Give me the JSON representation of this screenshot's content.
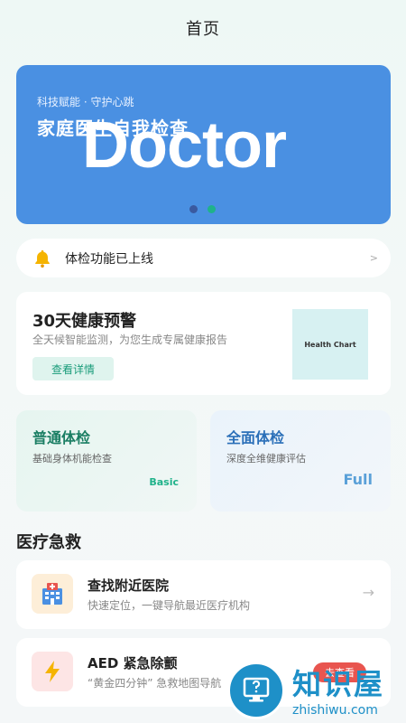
{
  "header": {
    "title": "首页"
  },
  "banner": {
    "subtitle": "科技赋能 · 守护心跳",
    "title": "家庭医生自我检查",
    "overlay_text": "Doctor",
    "background_color": "#4a90e2",
    "active_dot": 2,
    "dot_count": 2
  },
  "notice": {
    "icon": "bell-icon",
    "text": "体检功能已上线",
    "arrow": ">"
  },
  "warning_card": {
    "title": "30天健康预警",
    "description": "全天候智能监测，为您生成专属健康报告",
    "button_label": "查看详情",
    "image_label": "Health Chart"
  },
  "checkups": [
    {
      "title": "普通体检",
      "description": "基础身体机能检查",
      "tag": "Basic",
      "color": "#1a7e63"
    },
    {
      "title": "全面体检",
      "description": "深度全维健康评估",
      "tag": "Full",
      "color": "#2a6fb8"
    }
  ],
  "section": {
    "title": "医疗急救"
  },
  "emergency": [
    {
      "icon": "hospital-icon",
      "title": "查找附近医院",
      "description": "快速定位，一键导航最近医疗机构",
      "arrow": "→"
    },
    {
      "icon": "lightning-icon",
      "title": "AED 紧急除颤",
      "description": "“黄金四分钟” 急救地图导航",
      "badge": "去查看"
    }
  ],
  "watermark": {
    "icon": "question-monitor-icon",
    "text_cn": "知识屋",
    "text_en": "zhishiwu.com"
  }
}
